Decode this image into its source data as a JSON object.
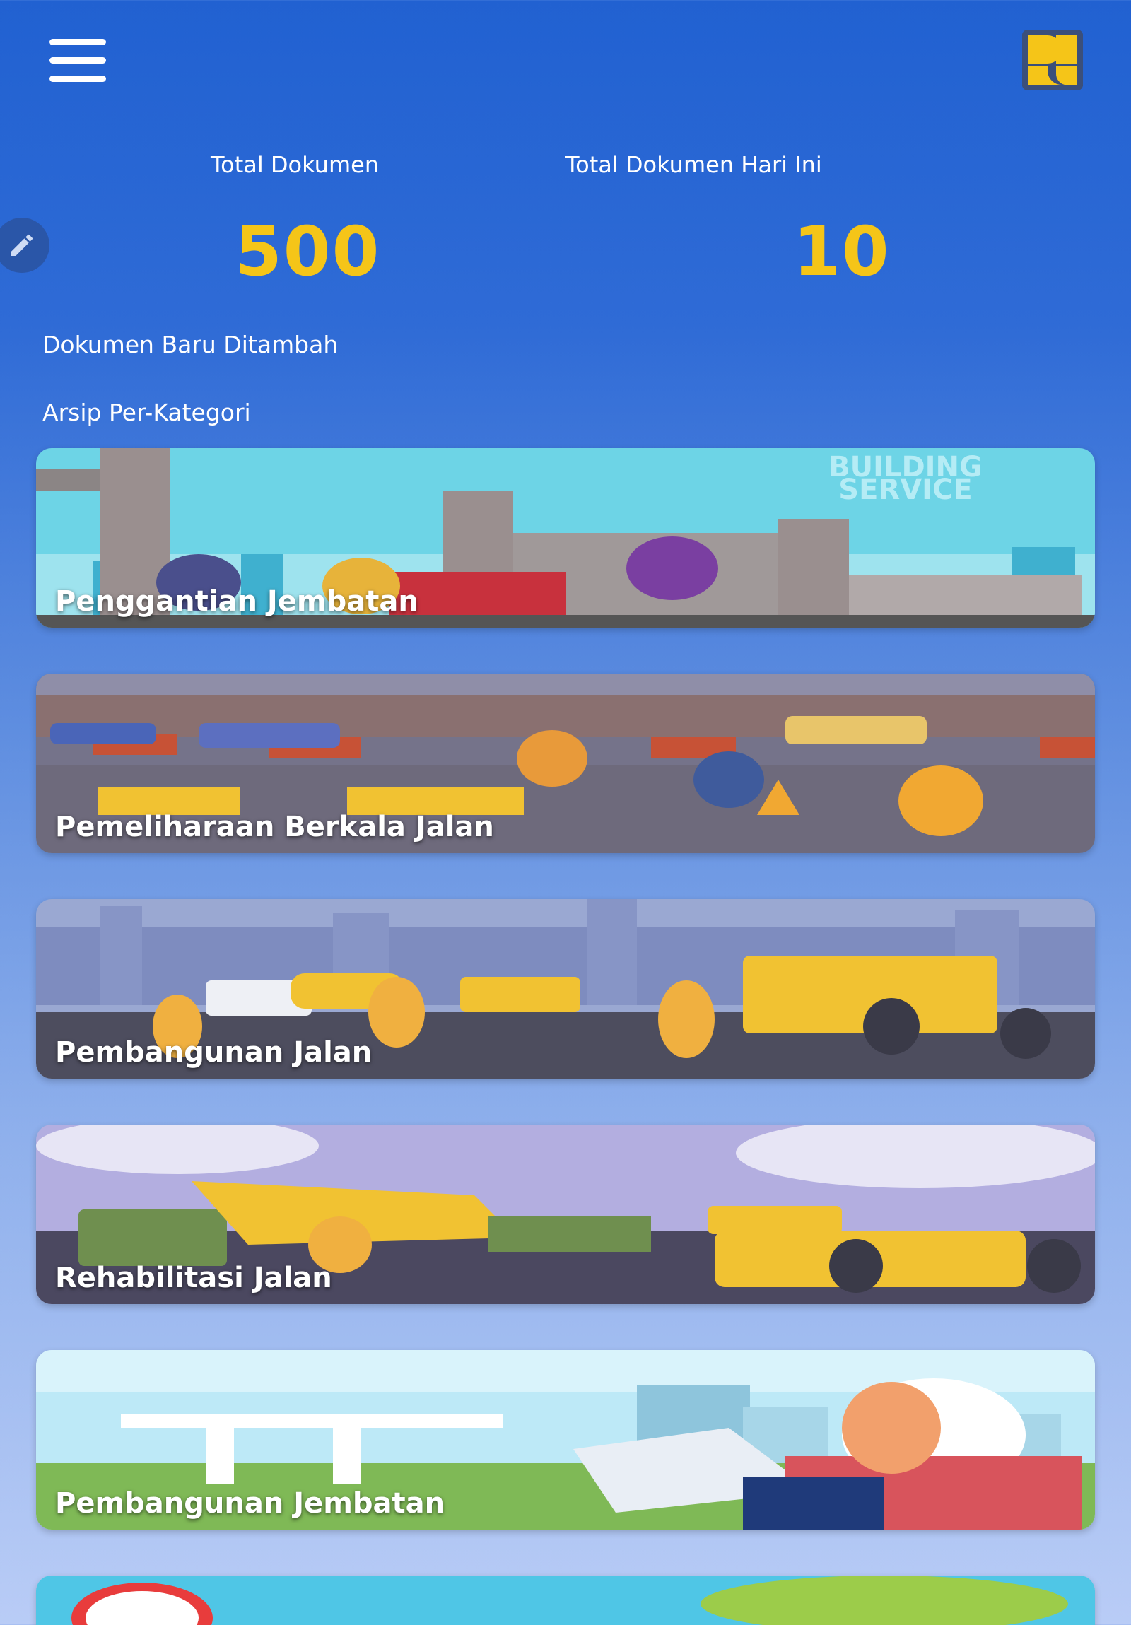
{
  "header": {
    "menu_icon": "hamburger-menu-icon",
    "logo_icon": "pupr-logo-icon"
  },
  "stats": {
    "total_label": "Total Dokumen",
    "total_value": "500",
    "today_label": "Total Dokumen Hari Ini",
    "today_value": "10",
    "value_color": "#f5c518"
  },
  "fab": {
    "icon": "pencil-icon"
  },
  "sections": {
    "new_docs": "Dokumen Baru Ditambah",
    "archive": "Arsip Per-Kategori"
  },
  "categories": [
    {
      "title": "Penggantian Jembatan"
    },
    {
      "title": "Pemeliharaan Berkala Jalan"
    },
    {
      "title": "Pembangunan Jalan"
    },
    {
      "title": "Rehabilitasi Jalan"
    },
    {
      "title": "Pembangunan Jembatan"
    }
  ],
  "colors": {
    "background_top": "#2161d1",
    "background_bottom": "#b9ccf6",
    "accent": "#f5c518"
  }
}
